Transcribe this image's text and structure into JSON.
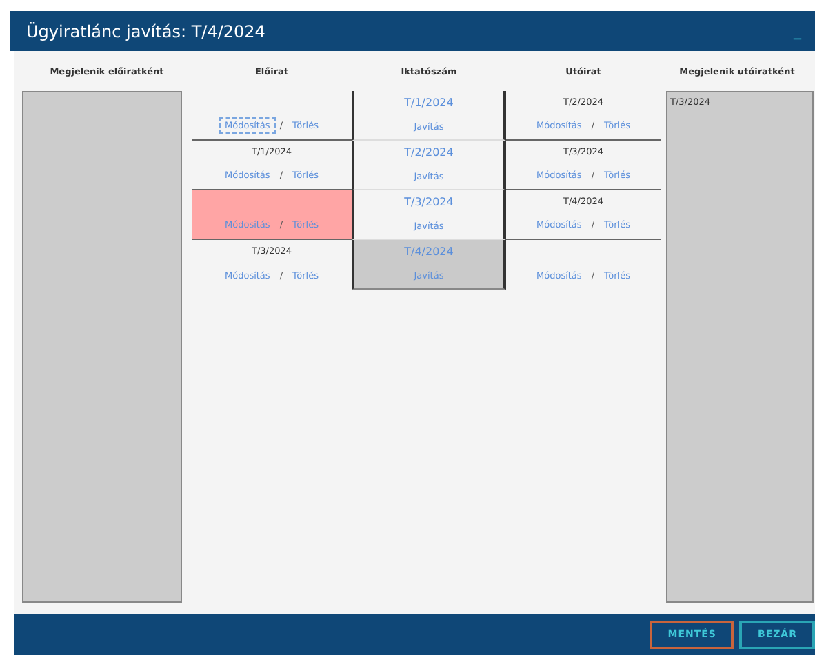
{
  "window": {
    "title": "Ügyiratlánc javítás: T/4/2024",
    "minimize": "_"
  },
  "columns": [
    "Megjelenik előiratként",
    "Előirat",
    "Iktatószám",
    "Utóirat",
    "Megjelenik utóiratként"
  ],
  "rows": [
    {
      "previous": {
        "highlighted": false,
        "edit": "Módosítás",
        "edit_focused": true,
        "sep": "/",
        "delete": "Törlés"
      },
      "filing": {
        "number": "T/1/2024",
        "action": "Javítás",
        "current": false
      },
      "next": {
        "number": "T/2/2024",
        "edit": "Módosítás",
        "sep": "/",
        "delete": "Törlés"
      }
    },
    {
      "previous": {
        "number": "T/1/2024",
        "highlighted": false,
        "edit": "Módosítás",
        "edit_focused": false,
        "sep": "/",
        "delete": "Törlés"
      },
      "filing": {
        "number": "T/2/2024",
        "action": "Javítás",
        "current": false
      },
      "next": {
        "number": "T/3/2024",
        "edit": "Módosítás",
        "sep": "/",
        "delete": "Törlés"
      }
    },
    {
      "previous": {
        "highlighted": true,
        "edit": "Módosítás",
        "edit_focused": false,
        "sep": "/",
        "delete": "Törlés"
      },
      "filing": {
        "number": "T/3/2024",
        "action": "Javítás",
        "current": false
      },
      "next": {
        "number": "T/4/2024",
        "edit": "Módosítás",
        "sep": "/",
        "delete": "Törlés"
      }
    },
    {
      "previous": {
        "number": "T/3/2024",
        "highlighted": false,
        "edit": "Módosítás",
        "edit_focused": false,
        "sep": "/",
        "delete": "Törlés"
      },
      "filing": {
        "number": "T/4/2024",
        "action": "Javítás",
        "current": true
      },
      "next": {
        "edit": "Módosítás",
        "sep": "/",
        "delete": "Törlés"
      }
    }
  ],
  "next_list": [
    "T/3/2024"
  ],
  "buttons": [
    {
      "label": "MENTÉS",
      "focused": true
    },
    {
      "label": "BEZÁR",
      "focused": false
    }
  ]
}
